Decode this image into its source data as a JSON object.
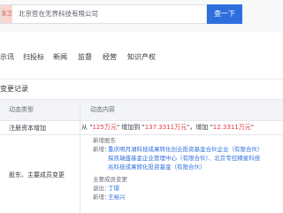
{
  "search": {
    "tag": "金卫",
    "value": "北京哲在无界科技有限公司",
    "button_label": "查一下"
  },
  "nav": {
    "items": [
      {
        "label": "示讯"
      },
      {
        "label": "扫投标"
      },
      {
        "label": "新闻"
      },
      {
        "label": "监督"
      },
      {
        "label": "经营"
      },
      {
        "label": "知识产权"
      }
    ]
  },
  "section": {
    "title": "变更记录"
  },
  "table": {
    "headers": {
      "type": "动态类型",
      "content": "动态内容"
    },
    "row1": {
      "type": "注册资本增加",
      "prefix": "从 \"",
      "from_value": "125万元",
      "mid": "\" 增加到 \"",
      "to_value": "137.3311万元",
      "suffix": "\"，增加 \"",
      "delta": "12.3311万元",
      "end": "\""
    },
    "row2": {
      "type": "股东、主要成员变更",
      "new_shareholders_label": "新增股东",
      "sh_1": "重庆明月湖科技成果转化创业投资基金合伙企业（有限合伙）",
      "sh_2": "探凯瑞盛基金企业管理中心（有限合伙）、北京专控精星科技",
      "sh_3": "兆科技成果转化投资基金（有限合伙）",
      "sh_prefix": "新增：",
      "members_label": "主要成员变更",
      "exit_label": "退出：",
      "exit_name": "丁璟",
      "new_label": "新增：",
      "new_name": "王裕兴"
    }
  }
}
